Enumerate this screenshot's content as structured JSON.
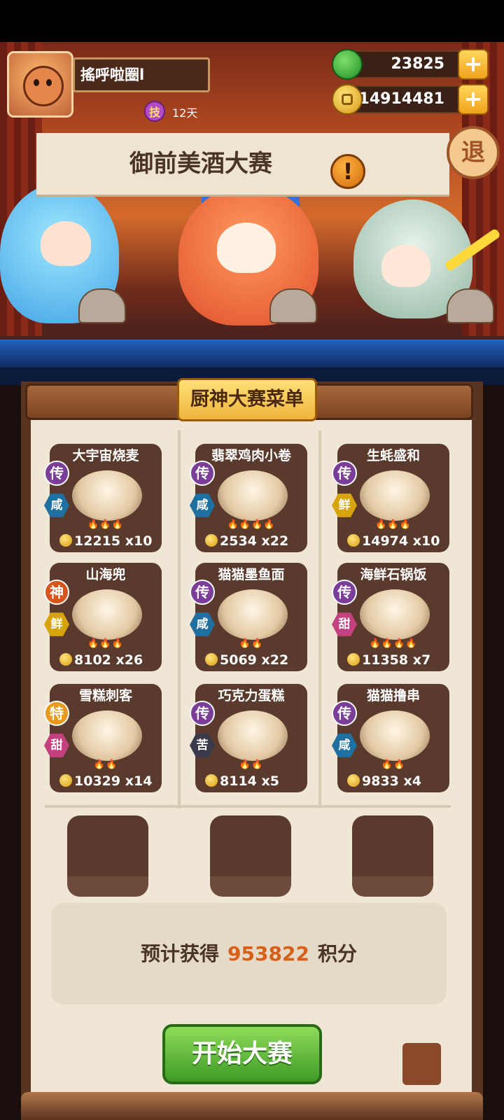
{
  "player": {
    "name": "搖呼啦圈l",
    "tech_label": "技",
    "tech_days": "12天"
  },
  "currency": {
    "jade": "23825",
    "coins": "14914481",
    "plus": "+"
  },
  "event": {
    "title": "御前美酒大赛",
    "alert": "!",
    "exit": "退"
  },
  "menu": {
    "title": "厨神大赛菜单",
    "dishes": [
      {
        "name": "大宇宙烧麦",
        "rarity": "传",
        "flavor": "咸",
        "flavor_color": "#1f6fa0",
        "fires": "🔥🔥🔥",
        "price": "12215",
        "qty": "x10"
      },
      {
        "name": "翡翠鸡肉小卷",
        "rarity": "传",
        "flavor": "咸",
        "flavor_color": "#1f6fa0",
        "fires": "🔥🔥🔥🔥",
        "price": "2534",
        "qty": "x22"
      },
      {
        "name": "生蚝盛和",
        "rarity": "传",
        "flavor": "鲜",
        "flavor_color": "#d7a40d",
        "fires": "🔥🔥🔥",
        "price": "14974",
        "qty": "x10"
      },
      {
        "name": "山海兜",
        "rarity": "神",
        "flavor": "鲜",
        "flavor_color": "#d7a40d",
        "fires": "🔥🔥🔥",
        "price": "8102",
        "qty": "x26",
        "rarity_color": "#d8541a"
      },
      {
        "name": "猫猫墨鱼面",
        "rarity": "传",
        "flavor": "咸",
        "flavor_color": "#1f6fa0",
        "fires": "🔥🔥",
        "price": "5069",
        "qty": "x22"
      },
      {
        "name": "海鲜石锅饭",
        "rarity": "传",
        "flavor": "甜",
        "flavor_color": "#c2417e",
        "fires": "🔥🔥🔥🔥",
        "price": "11358",
        "qty": "x7"
      },
      {
        "name": "雪糕刺客",
        "rarity": "特",
        "flavor": "甜",
        "flavor_color": "#c2417e",
        "fires": "🔥🔥",
        "price": "10329",
        "qty": "x14",
        "rarity_color": "#e99a1e"
      },
      {
        "name": "巧克力蛋糕",
        "rarity": "传",
        "flavor": "苦",
        "flavor_color": "#3a3a4a",
        "fires": "🔥🔥",
        "price": "8114",
        "qty": "x5"
      },
      {
        "name": "猫猫撸串",
        "rarity": "传",
        "flavor": "咸",
        "flavor_color": "#1f6fa0",
        "fires": "🔥🔥",
        "price": "9833",
        "qty": "x4"
      }
    ]
  },
  "estimate": {
    "label": "预计获得",
    "points": "953822",
    "unit": "积分"
  },
  "start_button": "开始大赛"
}
